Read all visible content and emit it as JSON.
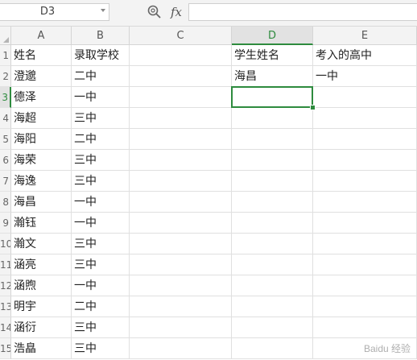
{
  "formula_bar": {
    "name_box": "D3",
    "fx_label": "fx",
    "formula": ""
  },
  "columns": [
    "A",
    "B",
    "C",
    "D",
    "E"
  ],
  "active_column": "D",
  "active_row": "3",
  "rows": [
    {
      "num": "1",
      "cells": [
        "姓名",
        "录取学校",
        "",
        "学生姓名",
        "考入的高中"
      ]
    },
    {
      "num": "2",
      "cells": [
        "澄邈",
        "二中",
        "",
        "海昌",
        "一中"
      ]
    },
    {
      "num": "3",
      "cells": [
        "德泽",
        "一中",
        "",
        "",
        ""
      ]
    },
    {
      "num": "4",
      "cells": [
        "海超",
        "三中",
        "",
        "",
        ""
      ]
    },
    {
      "num": "5",
      "cells": [
        "海阳",
        "二中",
        "",
        "",
        ""
      ]
    },
    {
      "num": "6",
      "cells": [
        "海荣",
        "三中",
        "",
        "",
        ""
      ]
    },
    {
      "num": "7",
      "cells": [
        "海逸",
        "三中",
        "",
        "",
        ""
      ]
    },
    {
      "num": "8",
      "cells": [
        "海昌",
        "一中",
        "",
        "",
        ""
      ]
    },
    {
      "num": "9",
      "cells": [
        "瀚钰",
        "一中",
        "",
        "",
        ""
      ]
    },
    {
      "num": "10",
      "cells": [
        "瀚文",
        "三中",
        "",
        "",
        ""
      ]
    },
    {
      "num": "11",
      "cells": [
        "涵亮",
        "三中",
        "",
        "",
        ""
      ]
    },
    {
      "num": "12",
      "cells": [
        "涵煦",
        "一中",
        "",
        "",
        ""
      ]
    },
    {
      "num": "13",
      "cells": [
        "明宇",
        "二中",
        "",
        "",
        ""
      ]
    },
    {
      "num": "14",
      "cells": [
        "涵衍",
        "三中",
        "",
        "",
        ""
      ]
    },
    {
      "num": "15",
      "cells": [
        "浩皛",
        "三中",
        "",
        "",
        ""
      ]
    }
  ],
  "watermark": "Baidu 经验",
  "colors": {
    "accent": "#2e8b3e",
    "header_bg": "#f3f3f3",
    "gridline": "#e0e0e0"
  }
}
